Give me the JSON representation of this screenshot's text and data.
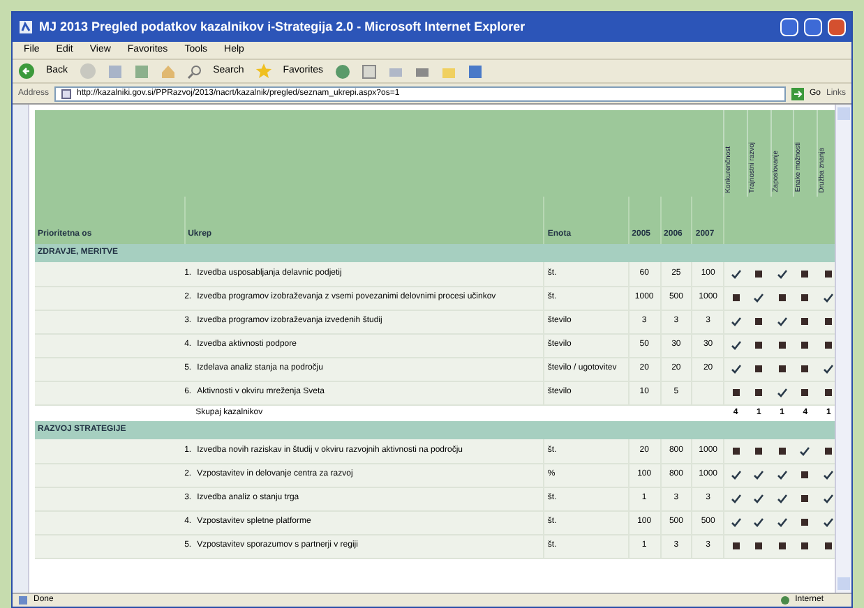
{
  "window": {
    "title": "MJ 2013 Pregled podatkov kazalnikov i-Strategija 2.0 - Microsoft Internet Explorer"
  },
  "menu": [
    "File",
    "Edit",
    "View",
    "Favorites",
    "Tools",
    "Help"
  ],
  "toolbar": {
    "back": "Back",
    "search": "Search",
    "favorites": "Favorites"
  },
  "address": {
    "label": "Address",
    "value": "http://kazalniki.gov.si/PPRazvoj/2013/nacrt/kazalnik/pregled/seznam_ukrepi.aspx?os=1",
    "go": "Go",
    "links": "Links"
  },
  "table": {
    "columns": [
      "Prioritetna os",
      "Ukrep",
      "Enota",
      "2005",
      "2006",
      "2007"
    ],
    "indicator_columns": [
      "Konkurenčnost",
      "Trajnostni razvoj",
      "Zaposlovanje",
      "Enake možnosti",
      "Družba znanja"
    ],
    "sections": [
      {
        "title": "ZDRAVJE, MERITVE",
        "rows": [
          {
            "number": "1.",
            "measure": "Izvedba usposabljanja delavnic podjetij",
            "unit": "št.",
            "values": [
              "60",
              "25",
              "100"
            ],
            "marks": [
              true,
              false,
              true,
              false,
              false
            ]
          },
          {
            "number": "2.",
            "measure": "Izvedba programov izobraževanja z vsemi povezanimi delovnimi procesi učinkov",
            "unit": "št.",
            "values": [
              "1000",
              "500",
              "1000"
            ],
            "marks": [
              false,
              true,
              false,
              false,
              true
            ]
          },
          {
            "number": "3.",
            "measure": "Izvedba programov izobraževanja izvedenih študij",
            "unit": "število",
            "values": [
              "3",
              "3",
              "3"
            ],
            "marks": [
              true,
              false,
              true,
              false,
              false
            ]
          },
          {
            "number": "4.",
            "measure": "Izvedba aktivnosti podpore",
            "unit": "število",
            "values": [
              "50",
              "30",
              "30"
            ],
            "marks": [
              true,
              false,
              false,
              false,
              false
            ]
          },
          {
            "number": "5.",
            "measure": "Izdelava analiz stanja na področju",
            "unit": "število / ugotovitev",
            "values": [
              "20",
              "20",
              "20"
            ],
            "marks": [
              true,
              false,
              false,
              false,
              true
            ]
          },
          {
            "number": "6.",
            "measure": "Aktivnosti v okviru mreženja Sveta",
            "unit": "število",
            "values": [
              "10",
              "5"
            ],
            "marks": [
              false,
              false,
              true,
              false,
              false
            ]
          }
        ],
        "summary": {
          "label": "Skupaj kazalnikov",
          "values": [
            "4",
            "1",
            "1",
            "4",
            "1"
          ]
        }
      },
      {
        "title": "RAZVOJ STRATEGIJE",
        "rows": [
          {
            "number": "1.",
            "measure": "Izvedba novih raziskav in študij v okviru razvojnih aktivnosti na področju",
            "unit": "št.",
            "values": [
              "20",
              "800",
              "1000"
            ],
            "marks": [
              false,
              false,
              false,
              true,
              false
            ]
          },
          {
            "number": "2.",
            "measure": "Vzpostavitev in delovanje centra za razvoj",
            "unit": "%",
            "values": [
              "100",
              "800",
              "1000"
            ],
            "marks": [
              true,
              true,
              true,
              false,
              true
            ]
          },
          {
            "number": "3.",
            "measure": "Izvedba analiz o stanju trga",
            "unit": "št.",
            "values": [
              "1",
              "3",
              "3"
            ],
            "marks": [
              true,
              true,
              true,
              false,
              true
            ]
          },
          {
            "number": "4.",
            "measure": "Vzpostavitev spletne platforme",
            "unit": "št.",
            "values": [
              "100",
              "500",
              "500"
            ],
            "marks": [
              true,
              true,
              true,
              false,
              true
            ]
          },
          {
            "number": "5.",
            "measure": "Vzpostavitev sporazumov s partnerji v regiji",
            "unit": "št.",
            "values": [
              "1",
              "3",
              "3"
            ],
            "marks": [
              false,
              false,
              false,
              false,
              false
            ]
          }
        ]
      }
    ]
  },
  "status_bar": {
    "text": "Done",
    "zone": "Internet"
  }
}
